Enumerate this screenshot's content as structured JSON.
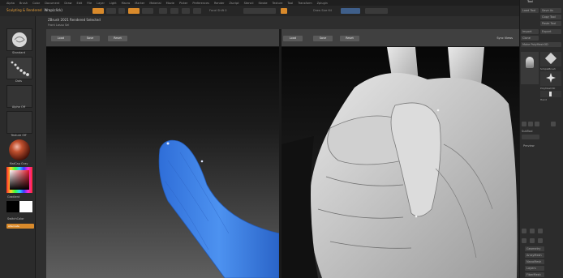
{
  "menubar": {
    "items": [
      "Alpha",
      "Brush",
      "Color",
      "Document",
      "Draw",
      "Edit",
      "File",
      "Layer",
      "Light",
      "Macro",
      "Marker",
      "Material",
      "Movie",
      "Picker",
      "Preferences",
      "Render",
      "Zscript",
      "Stencil",
      "Stroke",
      "Texture",
      "Tool",
      "Transform",
      "Zplugin"
    ]
  },
  "toolbar": {
    "title": "Sculpting & Rendered",
    "subtitle": "Wrap(click)",
    "texts": [
      "Mrgb",
      "Rgb",
      "M",
      "Zadd",
      "Zsub",
      "Focal Shift 0",
      "Draw Size 64",
      "Rgb Intensity",
      "Z Intensity"
    ]
  },
  "leftshelf": {
    "tiles": [
      {
        "label": "Standard",
        "icon": "brush-icon"
      },
      {
        "label": "Dots",
        "icon": "stroke-dots-icon"
      },
      {
        "label": "Alpha Off",
        "icon": "alpha-icon"
      },
      {
        "label": "Texture Off",
        "icon": "texture-icon"
      },
      {
        "label": "MatCap Gray",
        "icon": "material-sphere-icon"
      }
    ],
    "gradient_label": "Gradient",
    "switch_label": "SwitchColor",
    "alternate_label": "Alternate"
  },
  "window": {
    "title": "ZBrush 2021 Rendered Selected",
    "subtitle": "Front  Lasso Sel"
  },
  "left_panel": {
    "buttons": [
      "Load",
      "Save",
      "Reset"
    ]
  },
  "right_panel": {
    "buttons": [
      "Load",
      "Save",
      "Reset"
    ],
    "sync_label": "Sync Views"
  },
  "rightshelf": {
    "top_title": "Tool",
    "rows": [
      "Load Tool",
      "Save As",
      "Copy Tool",
      "Paste Tool",
      "Import",
      "Export",
      "Clone",
      "Make PolyMesh3D",
      "GoZ",
      "All",
      "Visible",
      "R"
    ],
    "thumb_labels": [
      "SimpleBrush",
      "PolyMesh3D",
      "Hand",
      "Mannequin"
    ],
    "lower_rows": [
      "SubTool",
      "Geometry",
      "ArrayMesh",
      "NanoMesh",
      "Layers",
      "FiberMesh",
      "Geometry HD",
      "Preview"
    ]
  },
  "colors": {
    "accent_orange": "#d98a2b",
    "viewport_mesh_blue": "#3d7fe0",
    "sculpt_gray": "#c8c8c8",
    "panel_bg": "#2b2b2b"
  }
}
